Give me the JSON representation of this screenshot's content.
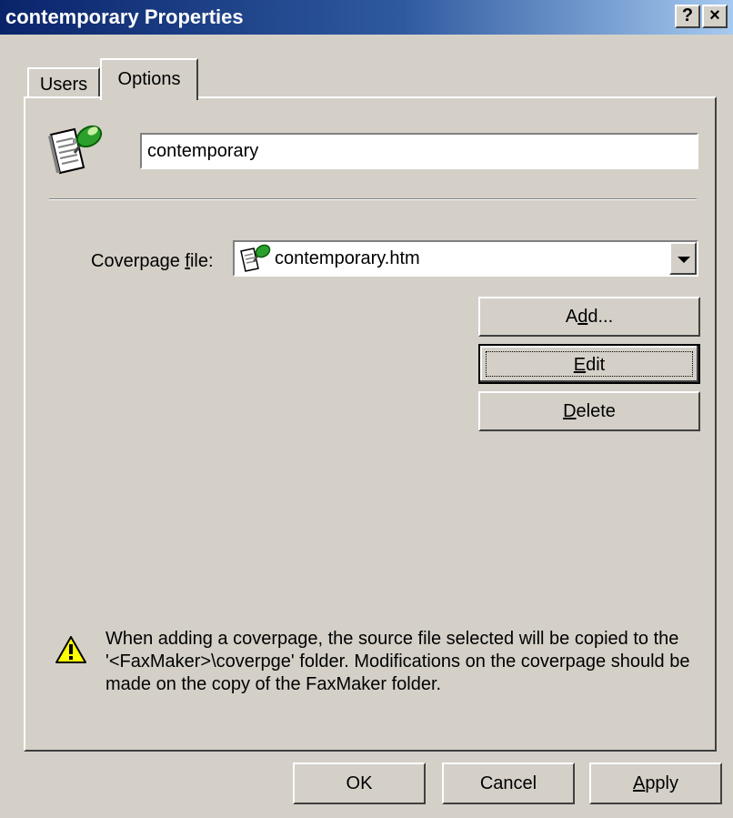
{
  "window": {
    "title": "contemporary Properties",
    "help_button": "?",
    "close_button": "×"
  },
  "tabs": [
    {
      "label": "Users",
      "selected": false
    },
    {
      "label": "Options",
      "selected": true
    }
  ],
  "options": {
    "name_value": "contemporary",
    "coverpage_label_pre": "Coverpage ",
    "coverpage_label_mnemonic": "f",
    "coverpage_label_post": "ile:",
    "coverpage_selected": "contemporary.htm",
    "buttons": {
      "add_pre": "A",
      "add_mnemonic": "d",
      "add_post": "d...",
      "edit_mnemonic": "E",
      "edit_post": "dit",
      "delete_mnemonic": "D",
      "delete_post": "elete"
    },
    "warning_text": "When adding a coverpage, the source file selected will be copied to the '<FaxMaker>\\coverpge' folder. Modifications on the coverpage should be made on the copy of the FaxMaker folder."
  },
  "footer": {
    "ok": "OK",
    "cancel": "Cancel",
    "apply_mnemonic": "A",
    "apply_post": "pply"
  },
  "icons": {
    "document": "document-pin-icon",
    "warning": "warning-icon"
  },
  "colors": {
    "title_bar_start": "#0a246a",
    "title_bar_end": "#a6caf0",
    "face": "#d4d0c8"
  }
}
